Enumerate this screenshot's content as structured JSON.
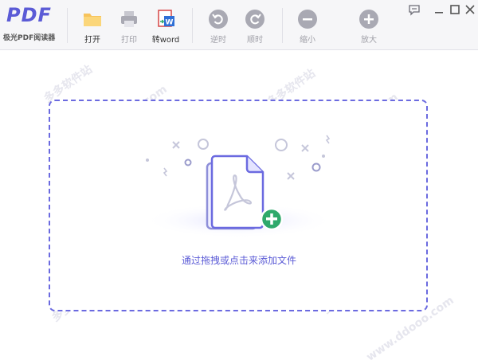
{
  "app": {
    "logo_mark": "PDF",
    "name": "极光PDF阅读器"
  },
  "toolbar": {
    "open_label": "打开",
    "print_label": "打印",
    "to_word_label": "转word",
    "rotate_ccw_label": "逆时",
    "rotate_cw_label": "顺时",
    "zoom_out_label": "缩小",
    "zoom_in_label": "放大"
  },
  "dropzone": {
    "hint": "通过拖拽或点击来添加文件"
  },
  "watermark": {
    "cn": "多多软件站",
    "url": "www.ddooo.com"
  },
  "colors": {
    "accent": "#5b5bd6",
    "add_badge": "#2fa96b",
    "folder": "#f7c35c"
  }
}
